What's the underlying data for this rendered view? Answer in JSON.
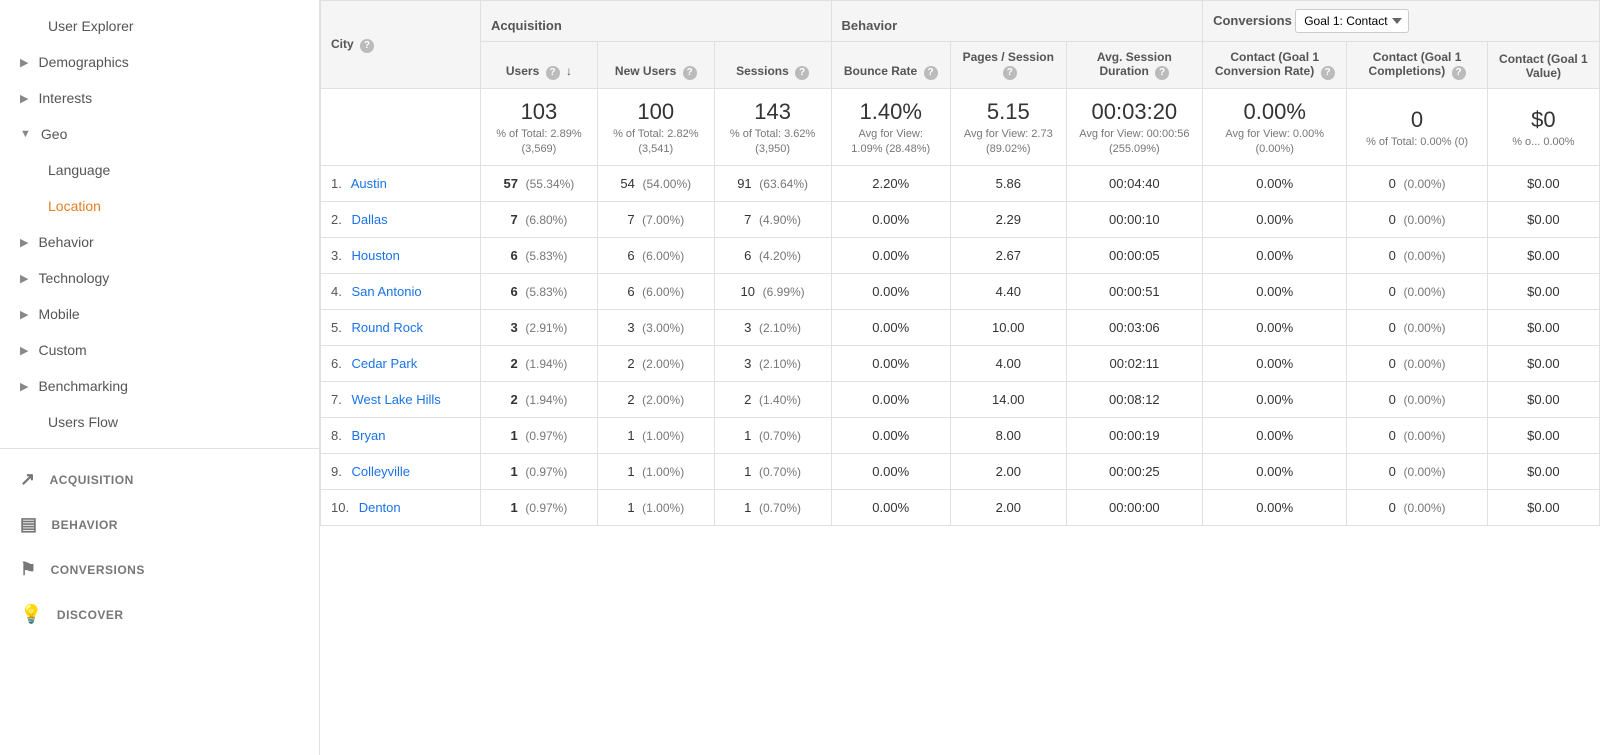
{
  "sidebar": {
    "items": [
      {
        "id": "user-explorer",
        "label": "User Explorer",
        "indent": 1,
        "arrow": false,
        "active": false
      },
      {
        "id": "demographics",
        "label": "Demographics",
        "indent": 0,
        "arrow": true,
        "arrowDir": "right",
        "active": false
      },
      {
        "id": "interests",
        "label": "Interests",
        "indent": 0,
        "arrow": true,
        "arrowDir": "right",
        "active": false
      },
      {
        "id": "geo",
        "label": "Geo",
        "indent": 0,
        "arrow": true,
        "arrowDir": "down",
        "active": false
      },
      {
        "id": "language",
        "label": "Language",
        "indent": 1,
        "arrow": false,
        "active": false
      },
      {
        "id": "location",
        "label": "Location",
        "indent": 1,
        "arrow": false,
        "active": true
      },
      {
        "id": "behavior",
        "label": "Behavior",
        "indent": 0,
        "arrow": true,
        "arrowDir": "right",
        "active": false
      },
      {
        "id": "technology",
        "label": "Technology",
        "indent": 0,
        "arrow": true,
        "arrowDir": "right",
        "active": false
      },
      {
        "id": "mobile",
        "label": "Mobile",
        "indent": 0,
        "arrow": true,
        "arrowDir": "right",
        "active": false
      },
      {
        "id": "custom",
        "label": "Custom",
        "indent": 0,
        "arrow": true,
        "arrowDir": "right",
        "active": false
      },
      {
        "id": "benchmarking",
        "label": "Benchmarking",
        "indent": 0,
        "arrow": true,
        "arrowDir": "right",
        "active": false
      },
      {
        "id": "users-flow",
        "label": "Users Flow",
        "indent": 1,
        "arrow": false,
        "active": false
      }
    ],
    "sections": [
      {
        "id": "acquisition",
        "label": "ACQUISITION",
        "icon": "↗"
      },
      {
        "id": "behavior",
        "label": "BEHAVIOR",
        "icon": "▤"
      },
      {
        "id": "conversions",
        "label": "CONVERSIONS",
        "icon": "⚑"
      },
      {
        "id": "discover",
        "label": "DISCOVER",
        "icon": "○"
      }
    ]
  },
  "table": {
    "city_header": "City",
    "acquisition_label": "Acquisition",
    "behavior_label": "Behavior",
    "conversions_label": "Conversions",
    "goal_select": "Goal 1: Contact",
    "columns": {
      "users": "Users",
      "new_users": "New Users",
      "sessions": "Sessions",
      "bounce_rate": "Bounce Rate",
      "pages_session": "Pages / Session",
      "avg_session": "Avg. Session Duration",
      "contact_rate": "Contact (Goal 1 Conversion Rate)",
      "contact_completions": "Contact (Goal 1 Completions)",
      "contact_value": "Contact (Goal 1 Value)"
    },
    "summary": {
      "users": "103",
      "users_sub": "% of Total: 2.89% (3,569)",
      "new_users": "100",
      "new_users_sub": "% of Total: 2.82% (3,541)",
      "sessions": "143",
      "sessions_sub": "% of Total: 3.62% (3,950)",
      "bounce_rate": "1.40%",
      "bounce_rate_sub": "Avg for View: 1.09% (28.48%)",
      "pages_session": "5.15",
      "pages_sub": "Avg for View: 2.73 (89.02%)",
      "avg_session": "00:03:20",
      "avg_session_sub": "Avg for View: 00:00:56 (255.09%)",
      "contact_rate": "0.00%",
      "contact_rate_sub": "Avg for View: 0.00% (0.00%)",
      "contact_completions": "0",
      "contact_completions_sub": "% of Total: 0.00% (0)",
      "contact_value": "$0",
      "contact_value_sub": "% o... 0.00%"
    },
    "rows": [
      {
        "rank": 1,
        "city": "Austin",
        "users": "57",
        "users_pct": "(55.34%)",
        "new_users": "54",
        "new_users_pct": "(54.00%)",
        "sessions": "91",
        "sessions_pct": "(63.64%)",
        "bounce_rate": "2.20%",
        "pages": "5.86",
        "avg_session": "00:04:40",
        "conv_rate": "0.00%",
        "completions": "0",
        "comp_pct": "(0.00%)",
        "value": "$0.00"
      },
      {
        "rank": 2,
        "city": "Dallas",
        "users": "7",
        "users_pct": "(6.80%)",
        "new_users": "7",
        "new_users_pct": "(7.00%)",
        "sessions": "7",
        "sessions_pct": "(4.90%)",
        "bounce_rate": "0.00%",
        "pages": "2.29",
        "avg_session": "00:00:10",
        "conv_rate": "0.00%",
        "completions": "0",
        "comp_pct": "(0.00%)",
        "value": "$0.00"
      },
      {
        "rank": 3,
        "city": "Houston",
        "users": "6",
        "users_pct": "(5.83%)",
        "new_users": "6",
        "new_users_pct": "(6.00%)",
        "sessions": "6",
        "sessions_pct": "(4.20%)",
        "bounce_rate": "0.00%",
        "pages": "2.67",
        "avg_session": "00:00:05",
        "conv_rate": "0.00%",
        "completions": "0",
        "comp_pct": "(0.00%)",
        "value": "$0.00"
      },
      {
        "rank": 4,
        "city": "San Antonio",
        "users": "6",
        "users_pct": "(5.83%)",
        "new_users": "6",
        "new_users_pct": "(6.00%)",
        "sessions": "10",
        "sessions_pct": "(6.99%)",
        "bounce_rate": "0.00%",
        "pages": "4.40",
        "avg_session": "00:00:51",
        "conv_rate": "0.00%",
        "completions": "0",
        "comp_pct": "(0.00%)",
        "value": "$0.00"
      },
      {
        "rank": 5,
        "city": "Round Rock",
        "users": "3",
        "users_pct": "(2.91%)",
        "new_users": "3",
        "new_users_pct": "(3.00%)",
        "sessions": "3",
        "sessions_pct": "(2.10%)",
        "bounce_rate": "0.00%",
        "pages": "10.00",
        "avg_session": "00:03:06",
        "conv_rate": "0.00%",
        "completions": "0",
        "comp_pct": "(0.00%)",
        "value": "$0.00"
      },
      {
        "rank": 6,
        "city": "Cedar Park",
        "users": "2",
        "users_pct": "(1.94%)",
        "new_users": "2",
        "new_users_pct": "(2.00%)",
        "sessions": "3",
        "sessions_pct": "(2.10%)",
        "bounce_rate": "0.00%",
        "pages": "4.00",
        "avg_session": "00:02:11",
        "conv_rate": "0.00%",
        "completions": "0",
        "comp_pct": "(0.00%)",
        "value": "$0.00"
      },
      {
        "rank": 7,
        "city": "West Lake Hills",
        "users": "2",
        "users_pct": "(1.94%)",
        "new_users": "2",
        "new_users_pct": "(2.00%)",
        "sessions": "2",
        "sessions_pct": "(1.40%)",
        "bounce_rate": "0.00%",
        "pages": "14.00",
        "avg_session": "00:08:12",
        "conv_rate": "0.00%",
        "completions": "0",
        "comp_pct": "(0.00%)",
        "value": "$0.00"
      },
      {
        "rank": 8,
        "city": "Bryan",
        "users": "1",
        "users_pct": "(0.97%)",
        "new_users": "1",
        "new_users_pct": "(1.00%)",
        "sessions": "1",
        "sessions_pct": "(0.70%)",
        "bounce_rate": "0.00%",
        "pages": "8.00",
        "avg_session": "00:00:19",
        "conv_rate": "0.00%",
        "completions": "0",
        "comp_pct": "(0.00%)",
        "value": "$0.00"
      },
      {
        "rank": 9,
        "city": "Colleyville",
        "users": "1",
        "users_pct": "(0.97%)",
        "new_users": "1",
        "new_users_pct": "(1.00%)",
        "sessions": "1",
        "sessions_pct": "(0.70%)",
        "bounce_rate": "0.00%",
        "pages": "2.00",
        "avg_session": "00:00:25",
        "conv_rate": "0.00%",
        "completions": "0",
        "comp_pct": "(0.00%)",
        "value": "$0.00"
      },
      {
        "rank": 10,
        "city": "Denton",
        "users": "1",
        "users_pct": "(0.97%)",
        "new_users": "1",
        "new_users_pct": "(1.00%)",
        "sessions": "1",
        "sessions_pct": "(0.70%)",
        "bounce_rate": "0.00%",
        "pages": "2.00",
        "avg_session": "00:00:00",
        "conv_rate": "0.00%",
        "completions": "0",
        "comp_pct": "(0.00%)",
        "value": "$0.00"
      }
    ]
  }
}
